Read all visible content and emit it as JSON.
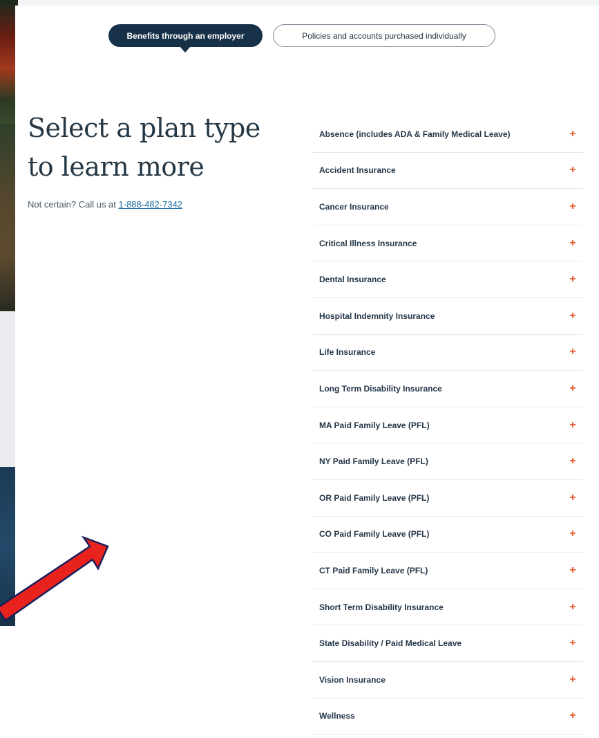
{
  "toggle": {
    "active_label": "Benefits through an employer",
    "inactive_label": "Policies and accounts purchased individually"
  },
  "main": {
    "heading_line1": "Select a plan type",
    "heading_line2": "to learn more",
    "call_prefix": "Not certain? Call us at ",
    "phone": "1-888-482-7342"
  },
  "plans": [
    {
      "label": "Absence (includes ADA & Family Medical Leave)"
    },
    {
      "label": "Accident Insurance"
    },
    {
      "label": "Cancer Insurance"
    },
    {
      "label": "Critical Illness Insurance"
    },
    {
      "label": "Dental Insurance"
    },
    {
      "label": "Hospital Indemnity Insurance"
    },
    {
      "label": "Life Insurance"
    },
    {
      "label": "Long Term Disability Insurance"
    },
    {
      "label": "MA Paid Family Leave (PFL)"
    },
    {
      "label": "NY Paid Family Leave (PFL)"
    },
    {
      "label": "OR Paid Family Leave (PFL)"
    },
    {
      "label": "CO Paid Family Leave (PFL)"
    },
    {
      "label": "CT Paid Family Leave (PFL)"
    },
    {
      "label": "Short Term Disability Insurance"
    },
    {
      "label": "State Disability / Paid Medical Leave"
    },
    {
      "label": "Vision Insurance"
    },
    {
      "label": "Wellness"
    }
  ],
  "icons": {
    "expand": "plus-icon",
    "plus_glyph": "+"
  },
  "colors": {
    "navy": "#173149",
    "accent_orange": "#e5572b",
    "link_blue": "#1d6fa5",
    "arrow_red": "#e8231e"
  }
}
